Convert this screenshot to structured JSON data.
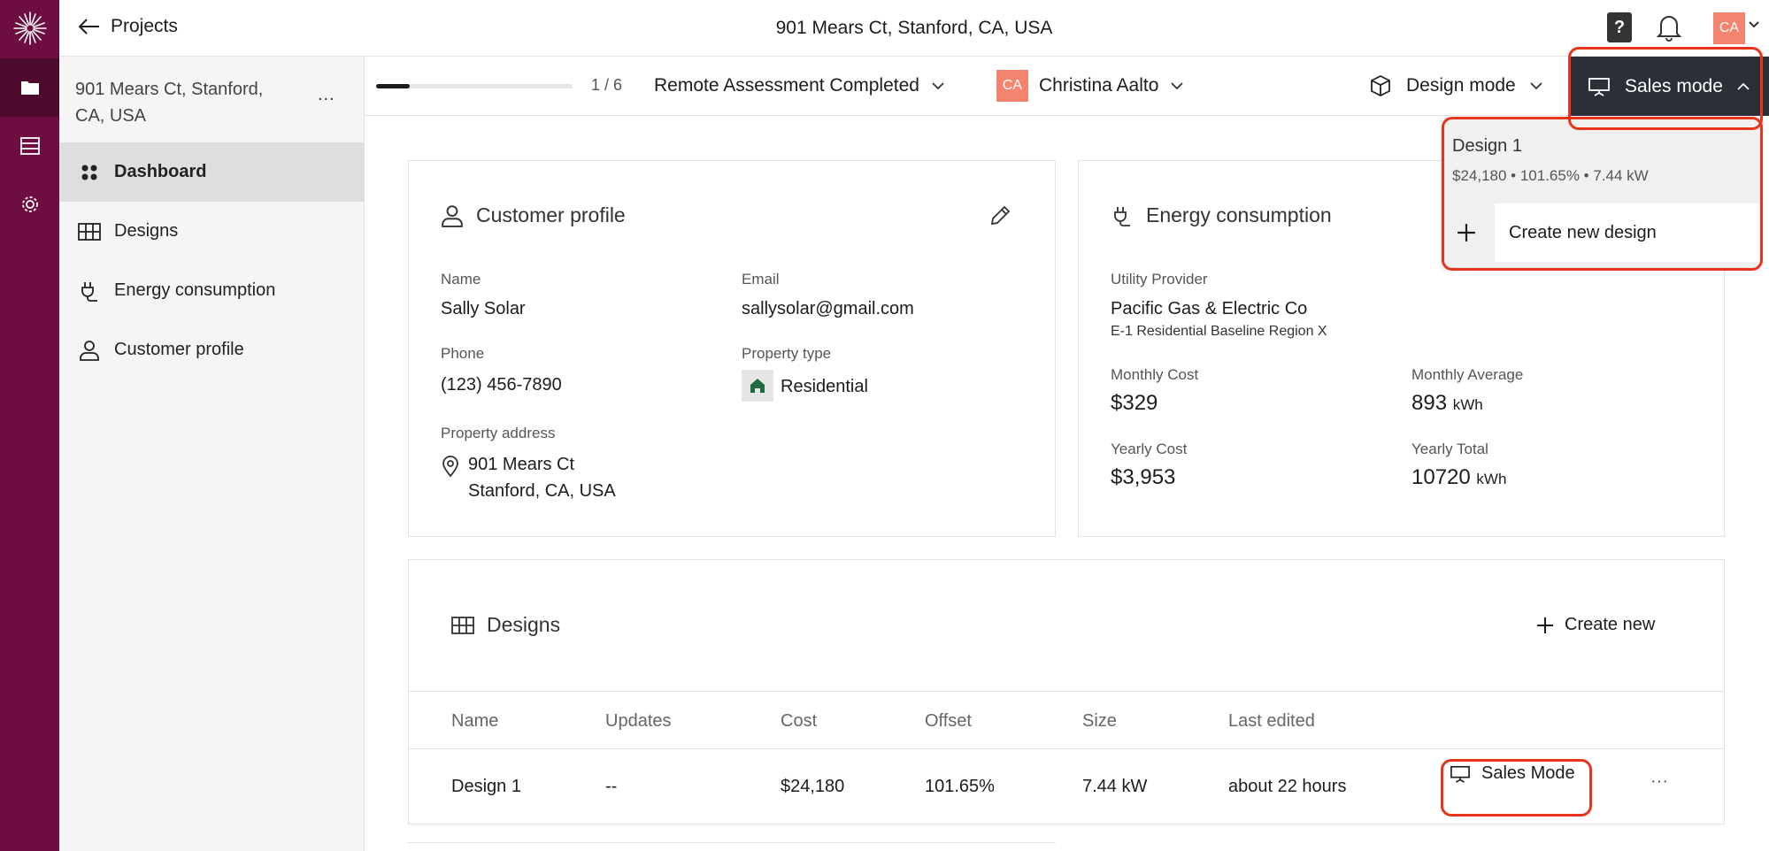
{
  "topbar": {
    "back_label": "Projects",
    "title": "901 Mears Ct, Stanford, CA, USA",
    "help_label": "?",
    "avatar_initials": "CA"
  },
  "sidebar": {
    "address": "901 Mears Ct, Stanford, CA, USA",
    "more_label": "...",
    "items": [
      {
        "label": "Dashboard",
        "icon": "dashboard-icon",
        "active": true
      },
      {
        "label": "Designs",
        "icon": "grid-icon"
      },
      {
        "label": "Energy consumption",
        "icon": "plug-icon"
      },
      {
        "label": "Customer profile",
        "icon": "person-icon"
      }
    ]
  },
  "subheader": {
    "progress": 0.17,
    "step": "1 / 6",
    "status": "Remote Assessment Completed",
    "assignee_initials": "CA",
    "assignee": "Christina Aalto",
    "design_mode": "Design mode",
    "sales_mode": "Sales mode"
  },
  "dropdown": {
    "design_name": "Design 1",
    "design_summary": "$24,180 • 101.65% • 7.44 kW",
    "create_label": "Create new design"
  },
  "customer_profile": {
    "title": "Customer profile",
    "name_label": "Name",
    "name": "Sally Solar",
    "email_label": "Email",
    "email": "sallysolar@gmail.com",
    "phone_label": "Phone",
    "phone": "(123) 456-7890",
    "property_type_label": "Property type",
    "property_type": "Residential",
    "address_label": "Property address",
    "address_line1": "901 Mears Ct",
    "address_line2": "Stanford, CA, USA"
  },
  "energy": {
    "title": "Energy consumption",
    "provider_label": "Utility Provider",
    "provider": "Pacific Gas & Electric Co",
    "rate_plan": "E-1 Residential Baseline Region X",
    "monthly_cost_label": "Monthly Cost",
    "monthly_cost": "$329",
    "monthly_avg_label": "Monthly Average",
    "monthly_avg": "893",
    "monthly_avg_unit": "kWh",
    "yearly_cost_label": "Yearly Cost",
    "yearly_cost": "$3,953",
    "yearly_total_label": "Yearly Total",
    "yearly_total": "10720",
    "yearly_total_unit": "kWh"
  },
  "designs": {
    "title": "Designs",
    "create_label": "Create new",
    "columns": [
      "Name",
      "Updates",
      "Cost",
      "Offset",
      "Size",
      "Last edited"
    ],
    "rows": [
      {
        "name": "Design 1",
        "updates": "--",
        "cost": "$24,180",
        "offset": "101.65%",
        "size": "7.44 kW",
        "last_edited": "about 22 hours",
        "action": "Sales Mode",
        "more": "···"
      }
    ]
  },
  "colors": {
    "rail": "#6e0d3f",
    "accent": "#f4836f",
    "sales_mode_bg": "#2b3038",
    "highlight": "#e8341c"
  }
}
